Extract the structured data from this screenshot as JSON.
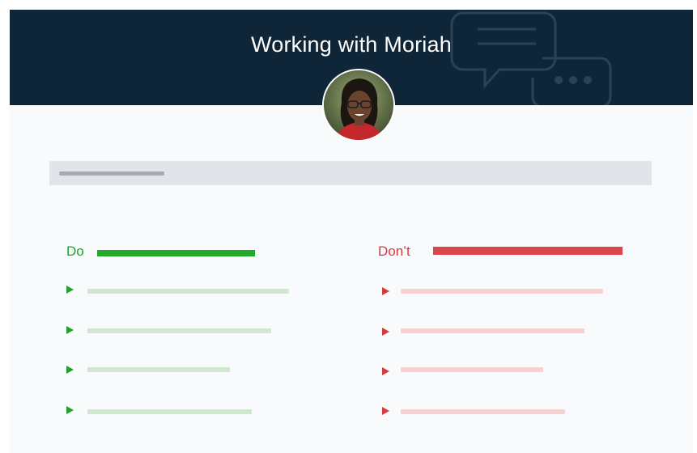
{
  "header": {
    "title": "Working with Moriah",
    "background_color": "#0f2639",
    "decoration_icon": "chat-bubbles-icon"
  },
  "profile": {
    "avatar_icon": "user-avatar-photo"
  },
  "search": {
    "placeholder": ""
  },
  "do_column": {
    "label": "Do",
    "color": "#1fa12a",
    "item_icon": "play-arrow-icon",
    "item_count": 4
  },
  "dont_column": {
    "label": "Don’t",
    "color": "#d63a3f",
    "item_icon": "play-arrow-icon",
    "item_count": 4
  }
}
